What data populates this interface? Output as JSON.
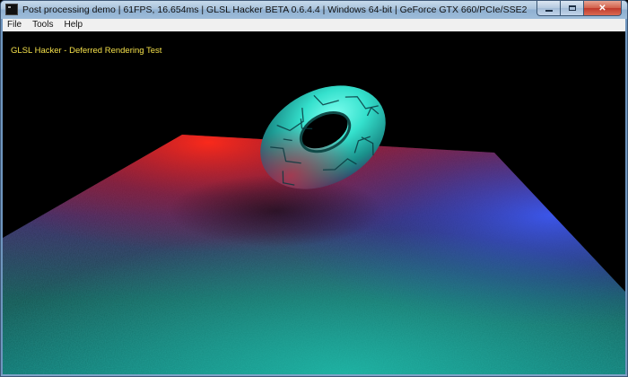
{
  "window": {
    "title": "Post processing demo | 61FPS, 16.654ms | GLSL Hacker BETA 0.6.4.4 | Windows 64-bit | GeForce GTX 660/PCIe/SSE2"
  },
  "menu": {
    "items": [
      {
        "label": "File"
      },
      {
        "label": "Tools"
      },
      {
        "label": "Help"
      }
    ]
  },
  "viewport": {
    "overlay_text": "GLSL Hacker - Deferred Rendering Test",
    "overlay_color": "#f4e04a",
    "background_color": "#000000"
  },
  "scene": {
    "objects": [
      "textured-floor-plane",
      "cracked-torus"
    ],
    "light_colors": [
      "#d0201c",
      "#6a2fb0",
      "#2a4fd0",
      "#1d9e86",
      "#19c0b0"
    ]
  }
}
